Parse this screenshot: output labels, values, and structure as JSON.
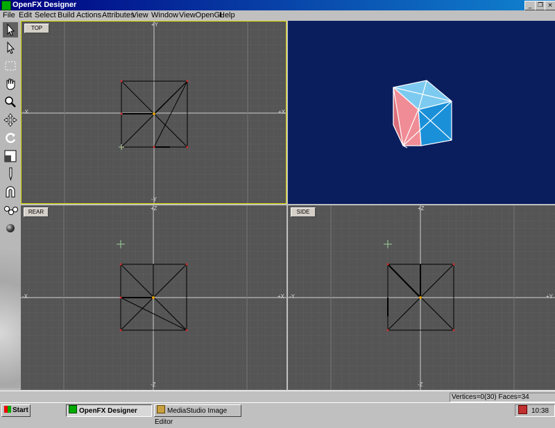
{
  "window": {
    "title": "OpenFX Designer",
    "min_label": "_",
    "restore_label": "❐",
    "close_label": "×"
  },
  "menu": [
    "File",
    "Edit",
    "Select",
    "Build",
    "Actions",
    "Attributes",
    "View",
    "Window",
    "ViewOpenGL",
    "Help"
  ],
  "viewports": {
    "top": {
      "label": "TOP",
      "axis_top": "+Y",
      "axis_bottom": "-Y",
      "axis_left": "-X",
      "axis_right": "+X"
    },
    "rear": {
      "label": "REAR",
      "axis_top": "+Z",
      "axis_bottom": "-Z",
      "axis_left": "-X",
      "axis_right": "+X"
    },
    "side": {
      "label": "SIDE",
      "axis_top": "+Z",
      "axis_bottom": "-Z",
      "axis_left": "-Y",
      "axis_right": "+Y"
    }
  },
  "colors": {
    "viewport_bg": "#555555",
    "grid": "#6a6a6a",
    "axis": "#d0d0d0",
    "perspective_bg": "#0a1e5e",
    "active_border": "#e0e000",
    "cube_blue": "#3aa8e8",
    "cube_pink": "#f08c96"
  },
  "status": {
    "text": "Vertices=0(30) Faces=34"
  },
  "taskbar": {
    "start": "Start",
    "task1": "OpenFX Designer",
    "task2": "MediaStudio Image Editor",
    "clock": "10:38"
  }
}
